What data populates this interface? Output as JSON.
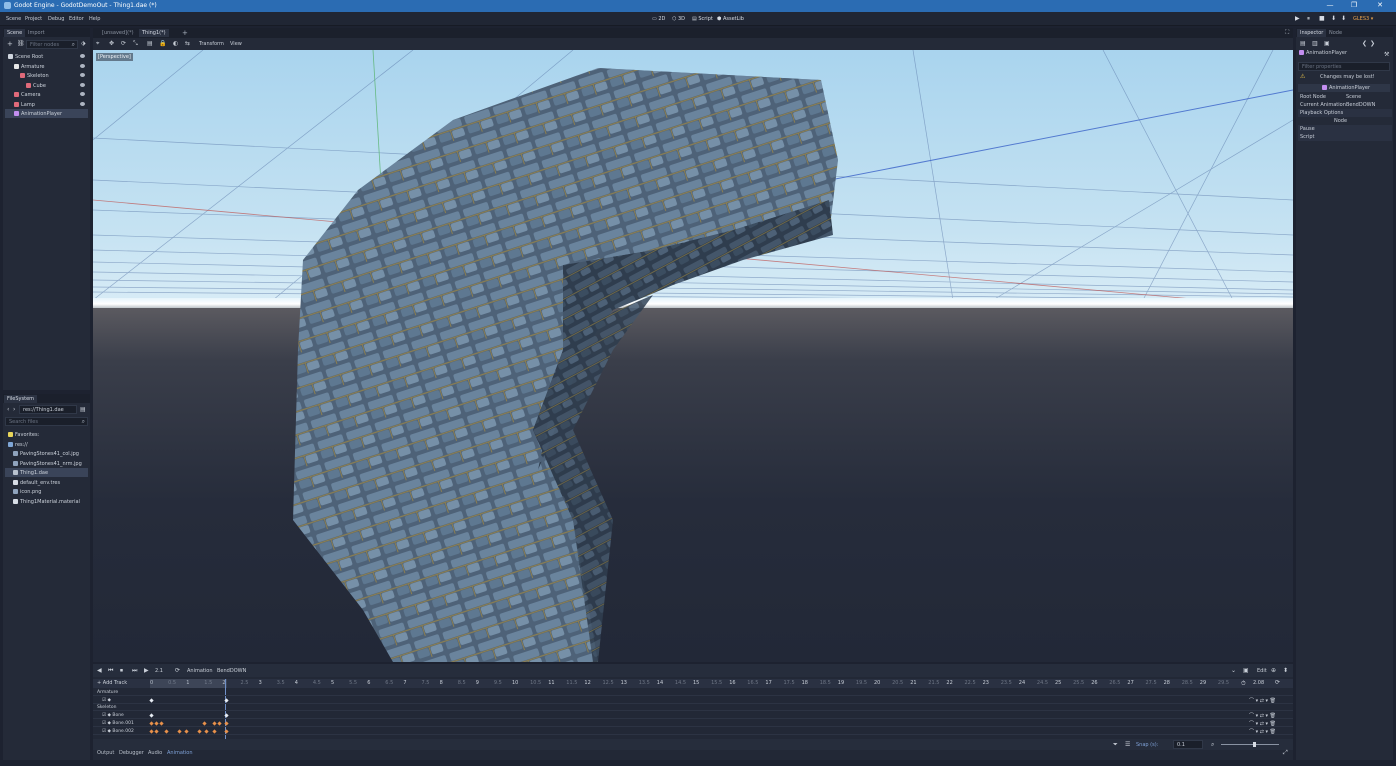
{
  "window": {
    "title": "Godot Engine - GodotDemoOut - Thing1.dae (*)",
    "min": "—",
    "max": "❐",
    "close": "✕"
  },
  "menu": [
    "Scene",
    "Project",
    "Debug",
    "Editor",
    "Help"
  ],
  "workspaces": [
    "2D",
    "3D",
    "Script",
    "AssetLib"
  ],
  "play_controls": [
    "▶",
    "⏸",
    "■",
    "⬇",
    "⬇",
    "▣"
  ],
  "renderer": "GLES3 ▾",
  "scene_dock": {
    "tabs": [
      "Scene",
      "Import"
    ],
    "filter_placeholder": "Filter nodes",
    "nodes": [
      {
        "label": "Scene Root",
        "indent": 0,
        "icon_color": "#cfd5de"
      },
      {
        "label": "Armature",
        "indent": 1,
        "icon_color": "#e8e8e8"
      },
      {
        "label": "Skeleton",
        "indent": 2,
        "icon_color": "#e06a7a"
      },
      {
        "label": "Cube",
        "indent": 3,
        "icon_color": "#e06a7a"
      },
      {
        "label": "Camera",
        "indent": 1,
        "icon_color": "#e06a7a"
      },
      {
        "label": "Lamp",
        "indent": 1,
        "icon_color": "#e06a7a"
      },
      {
        "label": "AnimationPlayer",
        "indent": 1,
        "icon_color": "#c38ef0",
        "selected": true
      }
    ]
  },
  "filesystem_dock": {
    "tab": "FileSystem",
    "path": "res://Thing1.dae",
    "search_placeholder": "Search files",
    "items": [
      {
        "label": "Favorites:",
        "indent": 0,
        "icon_color": "#e8d55a"
      },
      {
        "label": "res://",
        "indent": 0,
        "icon_color": "#7fa6d6"
      },
      {
        "label": "PavingStones41_col.jpg",
        "indent": 1,
        "icon_color": "#8fa3bd"
      },
      {
        "label": "PavingStones41_nrm.jpg",
        "indent": 1,
        "icon_color": "#8fa3bd"
      },
      {
        "label": "Thing1.dae",
        "indent": 1,
        "icon_color": "#b9c2cf",
        "selected": true
      },
      {
        "label": "default_env.tres",
        "indent": 1,
        "icon_color": "#d7dde6"
      },
      {
        "label": "icon.png",
        "indent": 1,
        "icon_color": "#8fa3bd"
      },
      {
        "label": "Thing1Material.material",
        "indent": 1,
        "icon_color": "#d7dde6"
      }
    ]
  },
  "editor_tabs": [
    {
      "label": "[unsaved](*)",
      "active": false
    },
    {
      "label": "Thing1(*)",
      "active": true
    }
  ],
  "viewport_toolbar": {
    "tools": [
      "⌖",
      "✥",
      "⟳",
      "⤡",
      "▤",
      "🔒",
      "◐",
      "⇆"
    ],
    "menus": [
      "Transform",
      "View"
    ],
    "perspective_label": "[Perspective]"
  },
  "animation": {
    "controls": [
      "◀",
      "⏮",
      "⏹",
      "⏭",
      "▶"
    ],
    "time": "2.1",
    "label": "Animation",
    "name": "BendDOWN",
    "edit": "Edit",
    "add_track": "+ Add Track",
    "length": "2.08",
    "ruler": [
      "0",
      "0.5",
      "1",
      "1.5",
      "2",
      "2.5",
      "3",
      "3.5",
      "4",
      "4.5",
      "5",
      "5.5",
      "6",
      "6.5",
      "7",
      "7.5",
      "8",
      "8.5",
      "9",
      "9.5",
      "10",
      "10.5",
      "11",
      "11.5",
      "12",
      "12.5",
      "13",
      "13.5",
      "14",
      "14.5",
      "15",
      "15.5",
      "16",
      "16.5",
      "17",
      "17.5",
      "18",
      "18.5",
      "19",
      "19.5",
      "20",
      "20.5",
      "21",
      "21.5",
      "22",
      "22.5",
      "23",
      "23.5",
      "24",
      "24.5",
      "25",
      "25.5",
      "26",
      "26.5",
      "27",
      "27.5",
      "28",
      "28.5",
      "29",
      "29.5"
    ],
    "tracks": [
      {
        "label": "Armature",
        "type": "header"
      },
      {
        "label": "☑ ◆",
        "type": "track"
      },
      {
        "label": "Skeleton",
        "type": "header"
      },
      {
        "label": "☑ ◆ Bone",
        "type": "track"
      },
      {
        "label": "☑ ◆ Bone.001",
        "type": "track"
      },
      {
        "label": "☑ ◆ Bone.002",
        "type": "track"
      }
    ],
    "snap_label": "Snap (s):",
    "snap_value": "0.1",
    "bottom_tabs": [
      "Output",
      "Debugger",
      "Audio",
      "Animation"
    ]
  },
  "inspector": {
    "tabs": [
      "Inspector",
      "Node"
    ],
    "filter_placeholder": "Filter properties",
    "warning": "Changes may be lost!",
    "node_name": "AnimationPlayer",
    "section": "AnimationPlayer",
    "props": [
      {
        "key": "Root Node",
        "value": "Scene"
      },
      {
        "key": "Current Animation",
        "value": "BendDOWN"
      },
      {
        "key": "Playback Options",
        "value": ""
      },
      {
        "key": "",
        "value": "Node"
      },
      {
        "key": "Pause",
        "value": ""
      },
      {
        "key": "Script",
        "value": ""
      }
    ]
  },
  "colors": {
    "accent": "#2b6cb3",
    "panel": "#242a38",
    "bg": "#1d2230",
    "selection": "#3a4459",
    "renderer": "#e7a14b"
  }
}
